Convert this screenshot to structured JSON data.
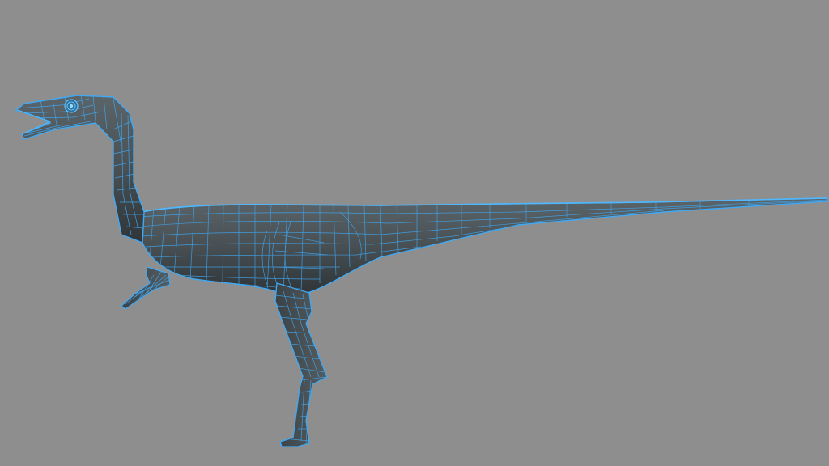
{
  "scene": {
    "background_color": "#8e8e8e",
    "mesh_fill_color": "#4a5256",
    "mesh_shade_color": "#3d4448",
    "wireframe_color": "#3fa9f5",
    "subject": "dinosaur-wireframe-model"
  }
}
